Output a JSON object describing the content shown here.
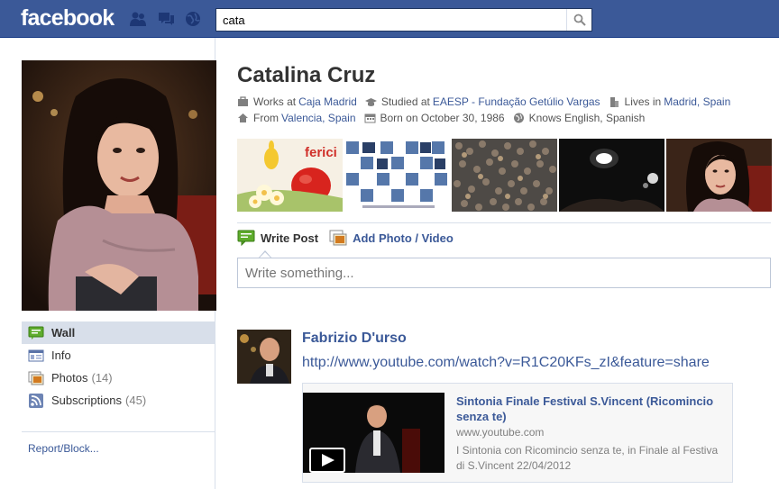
{
  "topbar": {
    "logo": "facebook",
    "search_value": "cata",
    "jewels": [
      "friend-requests-icon",
      "messages-icon",
      "notifications-icon"
    ]
  },
  "left": {
    "nav": [
      {
        "label": "Wall",
        "icon": "wall-icon",
        "selected": true
      },
      {
        "label": "Info",
        "icon": "info-icon"
      },
      {
        "label": "Photos",
        "icon": "photos-icon",
        "count": "(14)"
      },
      {
        "label": "Subscriptions",
        "icon": "subscriptions-icon",
        "count": "(45)"
      }
    ],
    "report": "Report/Block..."
  },
  "profile": {
    "name": "Catalina Cruz",
    "line1": [
      {
        "icon": "briefcase-icon",
        "prefix": "Works at",
        "link": "Caja Madrid"
      },
      {
        "icon": "graduation-cap-icon",
        "prefix": "Studied at",
        "link": "EAESP - Fundação Getúlio Vargas"
      },
      {
        "icon": "building-icon",
        "prefix": "Lives in",
        "link": "Madrid, Spain"
      }
    ],
    "line2": [
      {
        "icon": "home-icon",
        "prefix": "From",
        "link": "Valencia, Spain"
      },
      {
        "icon": "calendar-icon",
        "prefix": "Born on October 30, 1986"
      },
      {
        "icon": "globe-icon",
        "prefix": "Knows English, Spanish"
      }
    ],
    "strip_photo_text": "ferici"
  },
  "composer": {
    "tab_post": "Write Post",
    "tab_photo": "Add Photo / Video",
    "placeholder": "Write something..."
  },
  "story": {
    "author": "Fabrizio D'urso",
    "link": "http://www.youtube.com/watch?v=R1C20KFs_zI&feature=share",
    "attachment": {
      "title": "Sintonia Finale Festival S.Vincent (Ricomincio senza te)",
      "source": "www.youtube.com",
      "description": "I Sintonia con Ricomincio senza te, in Finale al Festiva di S.Vincent 22/04/2012"
    }
  },
  "colors": {
    "brand_blue": "#3b5998",
    "nav_selected": "#d8dfea",
    "border": "#bdc7d8"
  }
}
